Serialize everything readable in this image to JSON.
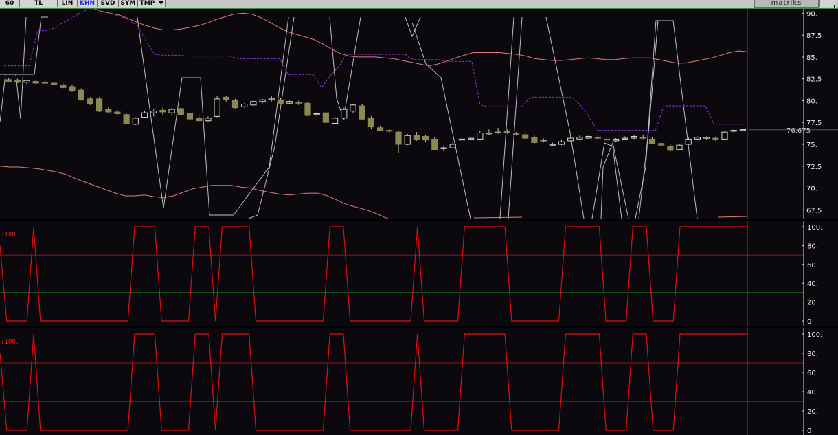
{
  "toolbar": {
    "buttons": [
      "60",
      "TL",
      "LIN",
      "KHN",
      "SVD",
      "SYM",
      "TMP"
    ],
    "active": "KHN",
    "menu_icon": "dropdown-arrow-icon",
    "brand": "matriks"
  },
  "price_panel": {
    "last_price": "76.675",
    "y_ticks": [
      "90.",
      "87.5",
      "85.",
      "82.5",
      "80.",
      "77.5",
      "75.",
      "72.5",
      "70.",
      "67.5"
    ]
  },
  "oscillator_1": {
    "label": ":100.",
    "y_ticks": [
      "100.",
      "80.",
      "60.",
      "40.",
      "20.",
      "0"
    ]
  },
  "oscillator_2": {
    "label": ":100.",
    "y_ticks": [
      "100.",
      "80.",
      "60.",
      "40.",
      "20.",
      "0"
    ]
  },
  "colors": {
    "background": "#0b080e",
    "candle": "#8a8a50",
    "upper_band": "#e07b7b",
    "stop_line": "#8a3be0",
    "oscillator": "#e01010",
    "level_high": "#8b1a1a",
    "level_low": "#1a7a1a",
    "cursor": "#8a2f9a"
  },
  "chart_data": [
    {
      "type": "line",
      "title": "",
      "ylim": [
        66.5,
        90.5
      ],
      "y_ticks": [
        90,
        87.5,
        85,
        82.5,
        80,
        77.5,
        75,
        72.5,
        70,
        67.5
      ],
      "last_value": 76.675,
      "candles": [
        {
          "o": 82.4,
          "h": 82.6,
          "l": 82.1,
          "c": 82.2
        },
        {
          "o": 82.3,
          "h": 82.5,
          "l": 82.0,
          "c": 82.1
        },
        {
          "o": 82.1,
          "h": 82.4,
          "l": 81.9,
          "c": 82.3
        },
        {
          "o": 82.2,
          "h": 82.4,
          "l": 81.9,
          "c": 82.0
        },
        {
          "o": 82.1,
          "h": 82.3,
          "l": 81.9,
          "c": 82.0
        },
        {
          "o": 82.0,
          "h": 82.2,
          "l": 81.7,
          "c": 81.8
        },
        {
          "o": 81.8,
          "h": 82.0,
          "l": 81.4,
          "c": 81.5
        },
        {
          "o": 81.6,
          "h": 81.8,
          "l": 81.0,
          "c": 81.1
        },
        {
          "o": 81.2,
          "h": 81.4,
          "l": 80.0,
          "c": 80.1
        },
        {
          "o": 80.2,
          "h": 80.4,
          "l": 79.5,
          "c": 79.6
        },
        {
          "o": 80.2,
          "h": 80.4,
          "l": 78.7,
          "c": 78.8
        },
        {
          "o": 79.0,
          "h": 79.2,
          "l": 78.6,
          "c": 78.7
        },
        {
          "o": 78.7,
          "h": 78.9,
          "l": 78.3,
          "c": 78.5
        },
        {
          "o": 78.4,
          "h": 78.5,
          "l": 77.3,
          "c": 77.4
        },
        {
          "o": 77.3,
          "h": 78.1,
          "l": 77.2,
          "c": 78.0
        },
        {
          "o": 78.1,
          "h": 78.8,
          "l": 78.0,
          "c": 78.6
        },
        {
          "o": 78.6,
          "h": 79.0,
          "l": 78.2,
          "c": 78.8
        },
        {
          "o": 78.9,
          "h": 79.2,
          "l": 78.4,
          "c": 78.7
        },
        {
          "o": 78.6,
          "h": 79.2,
          "l": 78.4,
          "c": 79.0
        },
        {
          "o": 79.1,
          "h": 79.3,
          "l": 78.3,
          "c": 78.4
        },
        {
          "o": 78.5,
          "h": 78.8,
          "l": 77.8,
          "c": 77.9
        },
        {
          "o": 78.0,
          "h": 78.3,
          "l": 77.6,
          "c": 77.7
        },
        {
          "o": 77.7,
          "h": 78.2,
          "l": 77.6,
          "c": 78.0
        },
        {
          "o": 78.2,
          "h": 80.5,
          "l": 78.1,
          "c": 80.2
        },
        {
          "o": 80.4,
          "h": 80.6,
          "l": 79.9,
          "c": 80.1
        },
        {
          "o": 80.0,
          "h": 80.2,
          "l": 79.1,
          "c": 79.2
        },
        {
          "o": 79.3,
          "h": 79.7,
          "l": 79.2,
          "c": 79.6
        },
        {
          "o": 79.5,
          "h": 80.0,
          "l": 79.4,
          "c": 79.9
        },
        {
          "o": 79.9,
          "h": 80.2,
          "l": 79.7,
          "c": 80.1
        },
        {
          "o": 80.1,
          "h": 80.5,
          "l": 79.9,
          "c": 80.2
        },
        {
          "o": 80.1,
          "h": 80.3,
          "l": 79.6,
          "c": 79.7
        },
        {
          "o": 79.7,
          "h": 80.0,
          "l": 79.6,
          "c": 79.9
        },
        {
          "o": 79.8,
          "h": 80.0,
          "l": 79.5,
          "c": 79.7
        },
        {
          "o": 79.7,
          "h": 79.9,
          "l": 78.2,
          "c": 78.3
        },
        {
          "o": 78.4,
          "h": 78.7,
          "l": 78.2,
          "c": 78.5
        },
        {
          "o": 78.6,
          "h": 78.8,
          "l": 77.4,
          "c": 77.5
        },
        {
          "o": 77.4,
          "h": 78.2,
          "l": 77.3,
          "c": 78.0
        },
        {
          "o": 78.0,
          "h": 79.2,
          "l": 77.8,
          "c": 79.0
        },
        {
          "o": 78.8,
          "h": 79.6,
          "l": 78.6,
          "c": 79.5
        },
        {
          "o": 79.4,
          "h": 79.6,
          "l": 77.8,
          "c": 77.9
        },
        {
          "o": 78.0,
          "h": 78.2,
          "l": 76.8,
          "c": 77.0
        },
        {
          "o": 76.9,
          "h": 77.1,
          "l": 76.5,
          "c": 76.6
        },
        {
          "o": 76.6,
          "h": 76.8,
          "l": 76.3,
          "c": 76.5
        },
        {
          "o": 76.4,
          "h": 76.6,
          "l": 74.0,
          "c": 75.0
        },
        {
          "o": 75.0,
          "h": 76.2,
          "l": 74.9,
          "c": 76.0
        },
        {
          "o": 76.0,
          "h": 76.4,
          "l": 75.4,
          "c": 75.6
        },
        {
          "o": 75.9,
          "h": 76.1,
          "l": 75.3,
          "c": 75.5
        },
        {
          "o": 75.6,
          "h": 75.8,
          "l": 74.3,
          "c": 74.4
        },
        {
          "o": 74.5,
          "h": 74.8,
          "l": 74.2,
          "c": 74.6
        },
        {
          "o": 74.6,
          "h": 75.2,
          "l": 74.5,
          "c": 75.0
        },
        {
          "o": 75.5,
          "h": 75.8,
          "l": 75.4,
          "c": 75.6
        },
        {
          "o": 75.6,
          "h": 75.9,
          "l": 75.5,
          "c": 75.7
        },
        {
          "o": 75.6,
          "h": 76.5,
          "l": 75.5,
          "c": 76.3
        },
        {
          "o": 76.2,
          "h": 76.7,
          "l": 76.1,
          "c": 76.3
        },
        {
          "o": 76.3,
          "h": 76.9,
          "l": 76.2,
          "c": 76.4
        },
        {
          "o": 76.5,
          "h": 76.7,
          "l": 76.2,
          "c": 76.3
        },
        {
          "o": 76.2,
          "h": 76.4,
          "l": 76.0,
          "c": 76.1
        },
        {
          "o": 76.1,
          "h": 76.3,
          "l": 75.6,
          "c": 75.7
        },
        {
          "o": 75.8,
          "h": 76.0,
          "l": 75.1,
          "c": 75.2
        },
        {
          "o": 75.4,
          "h": 75.7,
          "l": 75.2,
          "c": 75.5
        },
        {
          "o": 75.0,
          "h": 75.2,
          "l": 74.8,
          "c": 75.0
        },
        {
          "o": 75.0,
          "h": 75.5,
          "l": 74.9,
          "c": 75.3
        },
        {
          "o": 75.4,
          "h": 75.9,
          "l": 75.3,
          "c": 75.7
        },
        {
          "o": 75.6,
          "h": 76.0,
          "l": 75.5,
          "c": 75.8
        },
        {
          "o": 75.7,
          "h": 76.1,
          "l": 75.6,
          "c": 75.9
        },
        {
          "o": 75.8,
          "h": 76.0,
          "l": 75.5,
          "c": 75.7
        },
        {
          "o": 75.6,
          "h": 75.8,
          "l": 75.4,
          "c": 75.5
        },
        {
          "o": 75.4,
          "h": 75.7,
          "l": 75.3,
          "c": 75.6
        },
        {
          "o": 75.6,
          "h": 75.9,
          "l": 75.5,
          "c": 75.7
        },
        {
          "o": 75.7,
          "h": 76.0,
          "l": 75.6,
          "c": 75.9
        },
        {
          "o": 75.8,
          "h": 76.1,
          "l": 75.6,
          "c": 75.7
        },
        {
          "o": 75.6,
          "h": 75.8,
          "l": 75.0,
          "c": 75.1
        },
        {
          "o": 75.1,
          "h": 75.3,
          "l": 74.7,
          "c": 74.9
        },
        {
          "o": 74.8,
          "h": 75.0,
          "l": 74.2,
          "c": 74.3
        },
        {
          "o": 74.4,
          "h": 75.0,
          "l": 74.3,
          "c": 74.9
        },
        {
          "o": 75.0,
          "h": 75.8,
          "l": 74.9,
          "c": 75.6
        },
        {
          "o": 75.6,
          "h": 75.9,
          "l": 75.5,
          "c": 75.8
        },
        {
          "o": 75.7,
          "h": 75.9,
          "l": 75.5,
          "c": 75.8
        },
        {
          "o": 75.7,
          "h": 75.9,
          "l": 75.4,
          "c": 75.6
        },
        {
          "o": 75.6,
          "h": 76.5,
          "l": 75.5,
          "c": 76.4
        },
        {
          "o": 76.5,
          "h": 76.8,
          "l": 76.3,
          "c": 76.6
        },
        {
          "o": 76.6,
          "h": 76.8,
          "l": 76.5,
          "c": 76.7
        }
      ],
      "series": [
        {
          "values": [
            92.2,
            92.0,
            91.8,
            91.6,
            91.6,
            91.5,
            91.4,
            91.4,
            91.3,
            91.0,
            90.6,
            90.2,
            90.0,
            89.8,
            89.4,
            89.0,
            88.6,
            88.3,
            88.1,
            88.1,
            88.2,
            88.4,
            88.6,
            88.9,
            89.3,
            89.6,
            89.9,
            90.0,
            89.9,
            89.5,
            89.0,
            88.4,
            87.9,
            87.6,
            87.3,
            87.0,
            86.5,
            85.9,
            85.4,
            85.1,
            85.0,
            85.0,
            85.0,
            84.9,
            84.8,
            84.6,
            84.4,
            84.2,
            84.0,
            84.2,
            84.5,
            84.9,
            85.2,
            85.5,
            85.5,
            85.5,
            85.5,
            85.4,
            85.3,
            85.1,
            84.8,
            84.7,
            84.6,
            84.6,
            84.7,
            84.8,
            84.9,
            84.8,
            84.7,
            84.7,
            84.8,
            84.9,
            84.9,
            84.9,
            84.7,
            84.5,
            84.3,
            84.3,
            84.5,
            84.7,
            84.9,
            85.2,
            85.5,
            85.7,
            85.6
          ]
        },
        {
          "values": [
            84.0,
            84.0,
            84.0,
            84.0,
            88.0,
            88.0,
            88.3,
            88.9,
            89.4,
            90.0,
            90.4,
            90.4,
            90.2,
            89.9,
            89.6,
            89.1,
            88.6,
            86.8,
            85.3,
            85.2,
            85.2,
            85.2,
            85.1,
            85.1,
            85.1,
            85.1,
            85.1,
            85.1,
            84.8,
            84.8,
            84.8,
            84.8,
            84.8,
            84.8,
            83.0,
            83.0,
            83.0,
            83.0,
            81.5,
            82.8,
            83.8,
            85.3,
            85.3,
            85.3,
            85.3,
            85.3,
            85.3,
            85.3,
            85.3,
            84.7,
            84.7,
            84.7,
            84.7,
            84.5,
            84.5,
            84.5,
            84.5,
            79.5,
            79.3,
            79.3,
            79.3,
            79.3,
            79.3,
            80.4,
            80.4,
            80.4,
            80.4,
            80.4,
            80.4,
            79.5,
            78.2,
            76.6,
            76.6,
            76.6,
            76.6,
            76.6,
            76.6,
            76.6,
            76.6,
            79.4,
            79.4,
            79.4,
            79.4,
            79.4,
            79.4,
            77.3,
            77.3,
            77.3,
            77.3,
            77.3
          ]
        },
        {
          "values": [
            72.5,
            72.4,
            72.4,
            72.3,
            72.2,
            72.0,
            71.8,
            71.5,
            71.0,
            70.6,
            70.2,
            69.8,
            69.4,
            69.1,
            69.1,
            69.2,
            69.0,
            68.9,
            69.1,
            69.5,
            69.9,
            70.1,
            70.3,
            70.3,
            70.3,
            70.1,
            70.0,
            69.7,
            69.5,
            69.3,
            69.2,
            69.3,
            69.4,
            69.4,
            69.1,
            68.6,
            68.1,
            67.8,
            67.5,
            67.1,
            66.6,
            66.2
          ]
        }
      ],
      "oscillator_count": 2
    },
    {
      "type": "line",
      "title": "",
      "ylim": [
        0,
        100
      ],
      "y_ticks": [
        100,
        80,
        60,
        40,
        20,
        0
      ],
      "levels": [
        70,
        30
      ],
      "values": [
        80,
        0,
        0,
        0,
        0,
        100,
        0,
        0,
        0,
        0,
        0,
        0,
        0,
        0,
        0,
        0,
        0,
        0,
        0,
        0,
        100,
        100,
        100,
        100,
        0,
        0,
        0,
        0,
        0,
        100,
        100,
        100,
        0,
        100,
        100,
        100,
        100,
        100,
        0,
        0,
        0,
        0,
        0,
        0,
        0,
        0,
        0,
        0,
        0,
        100,
        100,
        100,
        0,
        0,
        0,
        0,
        0,
        0,
        0,
        0,
        0,
        0,
        100,
        0,
        0,
        0,
        0,
        0,
        0,
        100,
        100,
        100,
        100,
        100,
        100,
        100,
        0,
        0,
        0,
        0,
        0,
        0,
        0,
        0,
        100,
        100,
        100,
        100,
        100,
        100,
        0,
        0,
        0,
        0,
        100,
        100,
        100,
        0,
        0,
        0,
        0,
        100,
        100,
        100,
        100,
        100,
        100,
        100,
        100,
        100,
        100,
        100
      ]
    },
    {
      "type": "line",
      "title": "",
      "ylim": [
        0,
        100
      ],
      "y_ticks": [
        100,
        80,
        60,
        40,
        20,
        0
      ],
      "levels": [
        70,
        30
      ],
      "values": [
        80,
        0,
        0,
        0,
        0,
        100,
        0,
        0,
        0,
        0,
        0,
        0,
        0,
        0,
        0,
        0,
        0,
        0,
        0,
        0,
        100,
        100,
        100,
        100,
        0,
        0,
        0,
        0,
        0,
        100,
        100,
        100,
        0,
        100,
        100,
        100,
        100,
        100,
        0,
        0,
        0,
        0,
        0,
        0,
        0,
        0,
        0,
        0,
        0,
        100,
        100,
        100,
        0,
        0,
        0,
        0,
        0,
        0,
        0,
        0,
        0,
        0,
        100,
        0,
        0,
        0,
        0,
        0,
        0,
        100,
        100,
        100,
        100,
        100,
        100,
        100,
        0,
        0,
        0,
        0,
        0,
        0,
        0,
        0,
        100,
        100,
        100,
        100,
        100,
        100,
        0,
        0,
        0,
        0,
        100,
        100,
        100,
        0,
        0,
        0,
        0,
        100,
        100,
        100,
        100,
        100,
        100,
        100,
        100,
        100,
        100,
        100
      ]
    }
  ]
}
